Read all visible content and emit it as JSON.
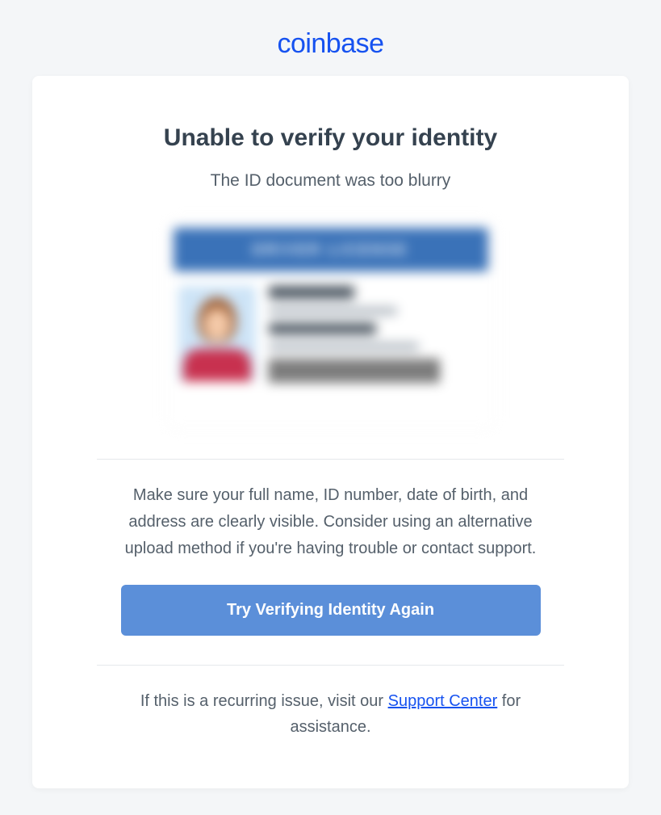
{
  "brand": "coinbase",
  "heading": "Unable to verify your identity",
  "subheading": "The ID document was too blurry",
  "id_header_text": "DRIVER LICENSE",
  "body_text": "Make sure your full name, ID number, date of birth, and address are clearly visible. Consider using an alternative upload method if you're having trouble or contact support.",
  "cta_label": "Try Verifying Identity Again",
  "footer_prefix": "If this is a recurring issue, visit our ",
  "footer_link": "Support Center",
  "footer_suffix": " for assistance."
}
